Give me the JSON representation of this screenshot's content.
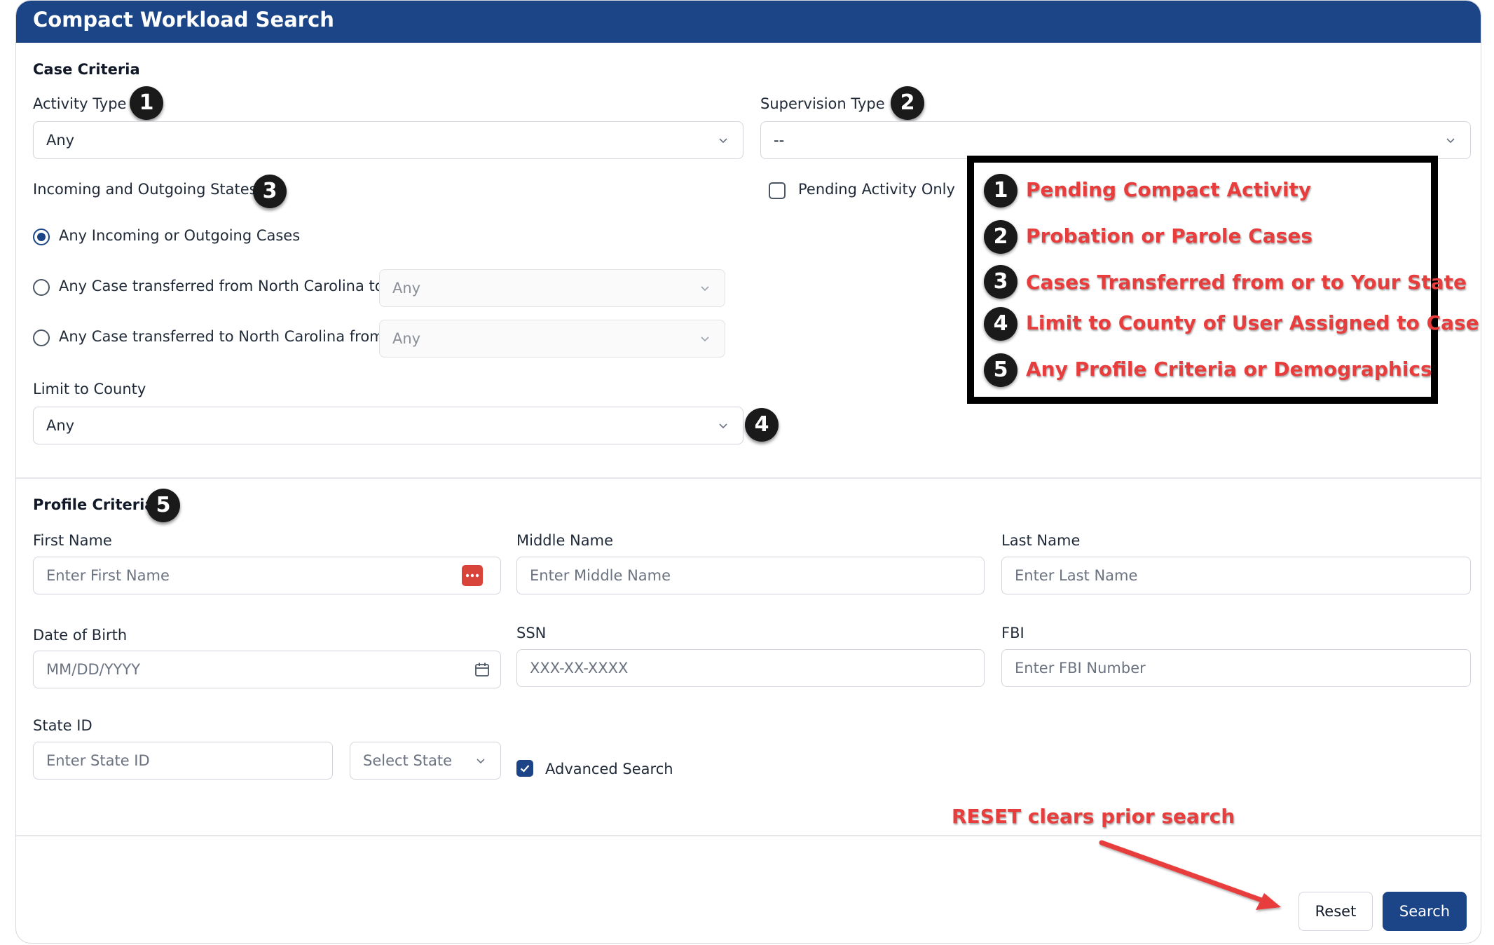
{
  "header": {
    "title": "Compact Workload Search"
  },
  "case_criteria": {
    "title": "Case Criteria",
    "activity_type": {
      "label": "Activity Type",
      "value": "Any",
      "badge": "1"
    },
    "supervision_type": {
      "label": "Supervision Type",
      "value": "--",
      "badge": "2"
    },
    "states": {
      "label": "Incoming and Outgoing States",
      "badge": "3",
      "options": [
        {
          "label": "Any Incoming or Outgoing Cases",
          "checked": true
        },
        {
          "label": "Any Case transferred from North Carolina to",
          "select_value": "Any",
          "checked": false
        },
        {
          "label": "Any Case transferred to North Carolina from",
          "select_value": "Any",
          "checked": false
        }
      ]
    },
    "pending_only": {
      "label": "Pending Activity Only",
      "checked": false
    },
    "county": {
      "label": "Limit to County",
      "value": "Any",
      "badge": "4"
    }
  },
  "profile_criteria": {
    "title": "Profile Criteria",
    "badge": "5",
    "first_name": {
      "label": "First Name",
      "placeholder": "Enter First Name"
    },
    "middle_name": {
      "label": "Middle Name",
      "placeholder": "Enter Middle Name"
    },
    "last_name": {
      "label": "Last Name",
      "placeholder": "Enter Last Name"
    },
    "dob": {
      "label": "Date of Birth",
      "placeholder": "MM/DD/YYYY"
    },
    "ssn": {
      "label": "SSN",
      "placeholder": "XXX-XX-XXXX"
    },
    "fbi": {
      "label": "FBI",
      "placeholder": "Enter FBI Number"
    },
    "state_id": {
      "label": "State ID",
      "placeholder": "Enter State ID",
      "state_select": "Select State"
    },
    "advanced_search": {
      "label": "Advanced Search",
      "checked": true
    }
  },
  "buttons": {
    "reset": "Reset",
    "search": "Search"
  },
  "annotations": {
    "callouts": [
      {
        "num": "1",
        "text": "Pending Compact Activity"
      },
      {
        "num": "2",
        "text": "Probation or Parole Cases"
      },
      {
        "num": "3",
        "text": "Cases Transferred from or to Your State"
      },
      {
        "num": "4",
        "text": "Limit to County of User Assigned to Case"
      },
      {
        "num": "5",
        "text": "Any Profile Criteria or Demographics"
      }
    ],
    "reset_note": "RESET clears prior search"
  },
  "colors": {
    "brand": "#1c4587",
    "annotation_red": "#e83d3d",
    "badge_black": "#1a1a1a"
  }
}
